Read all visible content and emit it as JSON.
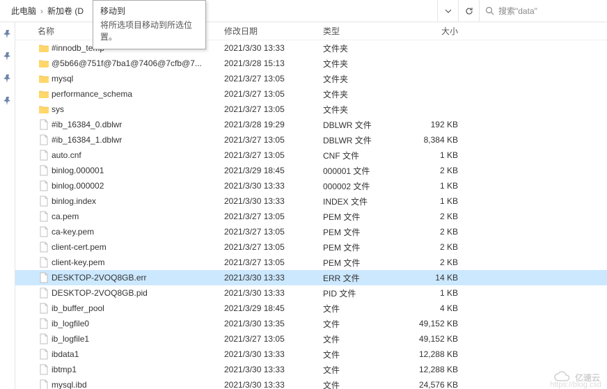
{
  "breadcrumb": {
    "item1": "此电脑",
    "item2": "新加卷 (D"
  },
  "tooltip": {
    "title": "移动到",
    "body": "将所选项目移动到所选位置。"
  },
  "search": {
    "placeholder": "搜索\"data\""
  },
  "columns": {
    "name": "名称",
    "date": "修改日期",
    "type": "类型",
    "size": "大小"
  },
  "files": [
    {
      "icon": "folder",
      "name": "#innodb_temp",
      "date": "2021/3/30 13:33",
      "type": "文件夹",
      "size": ""
    },
    {
      "icon": "folder",
      "name": "@5b66@751f@7ba1@7406@7cfb@7...",
      "date": "2021/3/28 15:13",
      "type": "文件夹",
      "size": ""
    },
    {
      "icon": "folder",
      "name": "mysql",
      "date": "2021/3/27 13:05",
      "type": "文件夹",
      "size": ""
    },
    {
      "icon": "folder",
      "name": "performance_schema",
      "date": "2021/3/27 13:05",
      "type": "文件夹",
      "size": ""
    },
    {
      "icon": "folder",
      "name": "sys",
      "date": "2021/3/27 13:05",
      "type": "文件夹",
      "size": ""
    },
    {
      "icon": "file",
      "name": "#ib_16384_0.dblwr",
      "date": "2021/3/28 19:29",
      "type": "DBLWR 文件",
      "size": "192 KB"
    },
    {
      "icon": "file",
      "name": "#ib_16384_1.dblwr",
      "date": "2021/3/27 13:05",
      "type": "DBLWR 文件",
      "size": "8,384 KB"
    },
    {
      "icon": "file",
      "name": "auto.cnf",
      "date": "2021/3/27 13:05",
      "type": "CNF 文件",
      "size": "1 KB"
    },
    {
      "icon": "file",
      "name": "binlog.000001",
      "date": "2021/3/29 18:45",
      "type": "000001 文件",
      "size": "2 KB"
    },
    {
      "icon": "file",
      "name": "binlog.000002",
      "date": "2021/3/30 13:33",
      "type": "000002 文件",
      "size": "1 KB"
    },
    {
      "icon": "file",
      "name": "binlog.index",
      "date": "2021/3/30 13:33",
      "type": "INDEX 文件",
      "size": "1 KB"
    },
    {
      "icon": "file",
      "name": "ca.pem",
      "date": "2021/3/27 13:05",
      "type": "PEM 文件",
      "size": "2 KB"
    },
    {
      "icon": "file",
      "name": "ca-key.pem",
      "date": "2021/3/27 13:05",
      "type": "PEM 文件",
      "size": "2 KB"
    },
    {
      "icon": "file",
      "name": "client-cert.pem",
      "date": "2021/3/27 13:05",
      "type": "PEM 文件",
      "size": "2 KB"
    },
    {
      "icon": "file",
      "name": "client-key.pem",
      "date": "2021/3/27 13:05",
      "type": "PEM 文件",
      "size": "2 KB"
    },
    {
      "icon": "file",
      "name": "DESKTOP-2VOQ8GB.err",
      "date": "2021/3/30 13:33",
      "type": "ERR 文件",
      "size": "14 KB",
      "selected": true
    },
    {
      "icon": "file",
      "name": "DESKTOP-2VOQ8GB.pid",
      "date": "2021/3/30 13:33",
      "type": "PID 文件",
      "size": "1 KB"
    },
    {
      "icon": "file",
      "name": "ib_buffer_pool",
      "date": "2021/3/29 18:45",
      "type": "文件",
      "size": "4 KB"
    },
    {
      "icon": "file",
      "name": "ib_logfile0",
      "date": "2021/3/30 13:35",
      "type": "文件",
      "size": "49,152 KB"
    },
    {
      "icon": "file",
      "name": "ib_logfile1",
      "date": "2021/3/27 13:05",
      "type": "文件",
      "size": "49,152 KB"
    },
    {
      "icon": "file",
      "name": "ibdata1",
      "date": "2021/3/30 13:33",
      "type": "文件",
      "size": "12,288 KB"
    },
    {
      "icon": "file",
      "name": "ibtmp1",
      "date": "2021/3/30 13:33",
      "type": "文件",
      "size": "12,288 KB"
    },
    {
      "icon": "file",
      "name": "mysql.ibd",
      "date": "2021/3/30 13:33",
      "type": "文件",
      "size": "24,576 KB"
    }
  ],
  "watermark": "亿速云"
}
